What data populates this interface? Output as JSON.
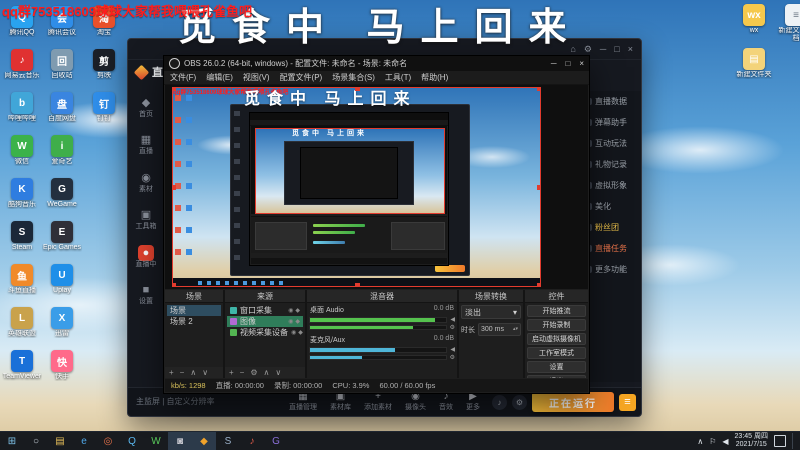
{
  "overlay": {
    "qq_banner": "qq群753518609球球大家帮我喂喂孔雀鱼吧",
    "away_text": "觅食中 马上回来"
  },
  "desktop": {
    "icons_left": [
      {
        "label": "腾讯QQ",
        "glyph": "Q",
        "color": "#29a3f0"
      },
      {
        "label": "网易云音乐",
        "glyph": "♪",
        "color": "#e03131"
      },
      {
        "label": "哔哩哔哩",
        "glyph": "b",
        "color": "#41a6d8"
      },
      {
        "label": "微信",
        "glyph": "W",
        "color": "#3bb24a"
      },
      {
        "label": "酷狗音乐",
        "glyph": "K",
        "color": "#2f7de0"
      },
      {
        "label": "Steam",
        "glyph": "S",
        "color": "#1b2838"
      },
      {
        "label": "斗鱼直播",
        "glyph": "鱼",
        "color": "#f08a2a"
      },
      {
        "label": "英雄联盟",
        "glyph": "L",
        "color": "#c9a24b"
      },
      {
        "label": "TeamViewer",
        "glyph": "T",
        "color": "#1a70d8"
      },
      {
        "label": "腾讯会议",
        "glyph": "会",
        "color": "#2f8de8"
      },
      {
        "label": "回收站",
        "glyph": "回",
        "color": "#7f9bb0"
      },
      {
        "label": "百度网盘",
        "glyph": "盘",
        "color": "#3a85e0"
      },
      {
        "label": "爱奇艺",
        "glyph": "i",
        "color": "#3fae4a"
      },
      {
        "label": "WeGame",
        "glyph": "G",
        "color": "#232f3e"
      },
      {
        "label": "Epic Games",
        "glyph": "E",
        "color": "#2f2f38"
      },
      {
        "label": "Uplay",
        "glyph": "U",
        "color": "#1f8fe8"
      },
      {
        "label": "迅雷",
        "glyph": "X",
        "color": "#3a9de8"
      },
      {
        "label": "快手",
        "glyph": "快",
        "color": "#ff6a8a"
      }
    ],
    "icons_mid": [
      {
        "label": "淘宝",
        "glyph": "淘",
        "color": "#e8502a"
      },
      {
        "label": "剪映",
        "glyph": "剪",
        "color": "#1b1f27"
      },
      {
        "label": "钉钉",
        "glyph": "钉",
        "color": "#2f8de8"
      }
    ],
    "icons_right": [
      {
        "label": "wx",
        "glyph": "wx",
        "color": "#f5c84c"
      },
      {
        "label": "新建文件夹",
        "glyph": "▤",
        "color": "#f3d37a"
      },
      {
        "label": "新建文本文档",
        "glyph": "≡",
        "color": "#eef2f5",
        "fg": "#6a7683"
      }
    ]
  },
  "companion": {
    "logo": "直播伴侣",
    "top_icons": [
      "⌂",
      "⚙",
      "─",
      "□",
      "×"
    ],
    "sidebar": [
      {
        "glyph": "◆",
        "label": "首页"
      },
      {
        "glyph": "▦",
        "label": "直播"
      },
      {
        "glyph": "◉",
        "label": "素材"
      },
      {
        "glyph": "▣",
        "label": "工具箱"
      },
      {
        "glyph": "●",
        "label": "直播中",
        "bg": "#e0422e",
        "color": "#ffffff"
      },
      {
        "glyph": "■",
        "label": "设置"
      }
    ],
    "right_panel": [
      {
        "label": "直播数据",
        "color": "#9aa0a8"
      },
      {
        "label": "弹幕助手",
        "color": "#9aa0a8"
      },
      {
        "label": "互动玩法",
        "color": "#9aa0a8"
      },
      {
        "label": "礼物记录",
        "color": "#9aa0a8"
      },
      {
        "label": "虚拟形象",
        "color": "#9aa0a8"
      },
      {
        "label": "美化",
        "color": "#9aa0a8"
      },
      {
        "label": "粉丝团",
        "color": "#f5c84c"
      },
      {
        "label": "直播任务",
        "color": "#e8734a"
      },
      {
        "label": "更多功能",
        "color": "#9aa0a8"
      }
    ],
    "toolbar": [
      {
        "glyph": "▦",
        "label": "直播管理"
      },
      {
        "glyph": "▣",
        "label": "素材库"
      },
      {
        "glyph": "+",
        "label": "添加素材"
      },
      {
        "glyph": "◉",
        "label": "摄像头"
      },
      {
        "glyph": "♪",
        "label": "音效"
      },
      {
        "glyph": "▶",
        "label": "更多"
      }
    ],
    "side_buttons": [
      "♪",
      "⚙"
    ],
    "running": "正在运行",
    "menu_glyph": "≡",
    "footer": "主监屏 | 自定义分辨率"
  },
  "obs": {
    "title": "OBS 26.0.2 (64-bit, windows) - 配置文件: 未命名 - 场景: 未命名",
    "win_buttons": [
      "─",
      "□",
      "×"
    ],
    "menu": [
      "文件(F)",
      "编辑(E)",
      "视图(V)",
      "配置文件(P)",
      "场景集合(S)",
      "工具(T)",
      "帮助(H)"
    ],
    "scenes": {
      "title": "场景",
      "rows": [
        {
          "label": "场景",
          "bg": "#2e4d60"
        },
        {
          "label": "场景 2",
          "bg": ""
        }
      ],
      "footer": [
        "+",
        "−",
        "∧",
        "∨"
      ]
    },
    "sources": {
      "title": "来源",
      "rows": [
        {
          "label": "窗口采集",
          "icon": "#3fb5a8",
          "bg": ""
        },
        {
          "label": "图像",
          "icon": "#b06ad4",
          "bg": "#2f7d5a"
        },
        {
          "label": "视频采集设备",
          "icon": "#53b552",
          "bg": ""
        }
      ],
      "footer": [
        "+",
        "−",
        "⚙",
        "∧",
        "∨"
      ]
    },
    "mixer": {
      "title": "混音器",
      "channels": [
        {
          "name": "桌面 Audio",
          "db": "0.0 dB",
          "color": "#55c24e",
          "w": "92%",
          "w2": "76%"
        },
        {
          "name": "麦克风/Aux",
          "db": "0.0 dB",
          "color": "#4fb6d8",
          "w": "62%",
          "w2": "38%"
        }
      ]
    },
    "transitions": {
      "title": "场景转换",
      "value": "淡出",
      "duration_label": "时长",
      "duration": "300 ms"
    },
    "controls": {
      "title": "控件",
      "buttons": [
        "开始推流",
        "开始录制",
        "启动虚拟摄像机",
        "工作室模式",
        "设置",
        "退出"
      ]
    },
    "status": [
      {
        "label": "kb/s: 1298",
        "color": "#d8c05a"
      },
      {
        "label": "直播: 00:00:00",
        "color": "#b0b0b0"
      },
      {
        "label": "录制: 00:00:00",
        "color": "#b0b0b0"
      },
      {
        "label": "CPU: 3.9%",
        "color": "#b0b0b0"
      },
      {
        "label": "60.00 / 60.00 fps",
        "color": "#b0b0b0"
      }
    ]
  },
  "taskbar": {
    "apps": [
      {
        "glyph": "⊞",
        "color": "#7fc4ea",
        "bg": ""
      },
      {
        "glyph": "○",
        "color": "#c8d2da",
        "bg": ""
      },
      {
        "glyph": "▤",
        "color": "#e8c05a",
        "bg": ""
      },
      {
        "glyph": "e",
        "color": "#4fa8e8",
        "bg": ""
      },
      {
        "glyph": "◎",
        "color": "#e8734a",
        "bg": ""
      },
      {
        "glyph": "Q",
        "color": "#5ab8f0",
        "bg": ""
      },
      {
        "glyph": "W",
        "color": "#58c85a",
        "bg": ""
      },
      {
        "glyph": "◙",
        "color": "#c8c8d0",
        "bg": "#2c3a4a"
      },
      {
        "glyph": "◆",
        "color": "#f0a22a",
        "bg": "#2c3a4a"
      },
      {
        "glyph": "S",
        "color": "#9ab0c8",
        "bg": ""
      },
      {
        "glyph": "♪",
        "color": "#e05b4a",
        "bg": ""
      },
      {
        "glyph": "G",
        "color": "#8a6fd8",
        "bg": ""
      }
    ],
    "tray_glyphs": [
      "∧",
      "⚐",
      "◀"
    ],
    "time": "23:45 周四",
    "date": "2021/7/15"
  }
}
